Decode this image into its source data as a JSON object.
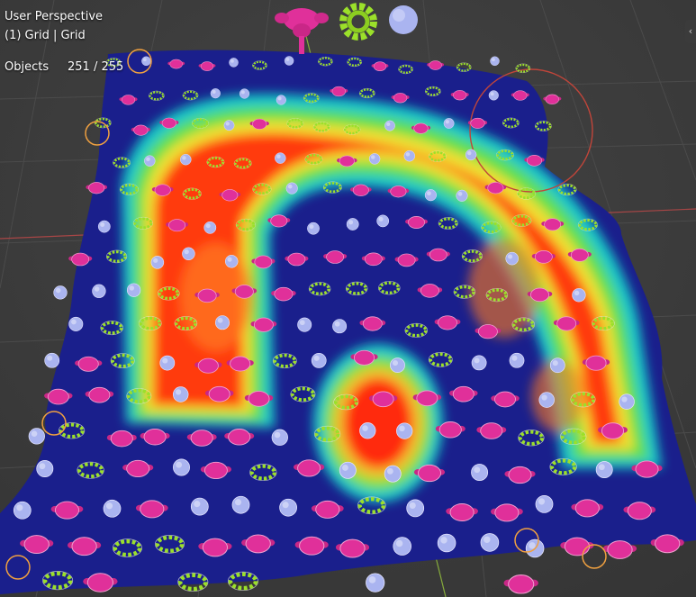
{
  "viewport": {
    "view_name": "User Perspective",
    "collection_line": "(1) Grid | Grid",
    "objects_label": "Objects",
    "objects_value": "251 / 255",
    "toggle_icon": "chevron-left-icon",
    "toggle_glyph": "‹"
  },
  "header_icons": [
    "monkey-head-icon",
    "gear-icon",
    "sphere-icon"
  ],
  "colors": {
    "background": "#3d3d3d",
    "grid_line": "#4a4a4a",
    "x_axis": "#b04a4a",
    "y_axis": "#8aae3f",
    "heat_low": "#1a1f8c",
    "heat_mid": "#19d7c8",
    "heat_high": "#ff2a10",
    "suzanne": "#e0309a",
    "gear": "#9be02a",
    "sphere": "#aab4f0",
    "selection_outline": "#f0a040"
  }
}
